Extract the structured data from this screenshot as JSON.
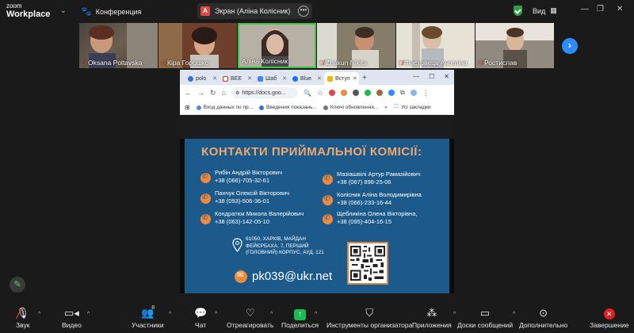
{
  "app": {
    "logo_top": "zoom",
    "logo_bottom": "Workplace"
  },
  "meeting": {
    "title": "Конференция"
  },
  "screen_share": {
    "badge": "А",
    "label": "Экран (Аліна Колісник)"
  },
  "view": {
    "label": "Вид"
  },
  "participants": [
    {
      "name": "Oksana Poltavska",
      "muted": true
    },
    {
      "name": "Кіра Горошко",
      "muted": true
    },
    {
      "name": "Аліна Колісник",
      "muted": false
    },
    {
      "name": "Zhakun Nikita",
      "muted": true
    },
    {
      "name": "Фастовець Ангеліна",
      "muted": true
    },
    {
      "name": "Ростислав",
      "muted": true
    }
  ],
  "browser": {
    "tabs": [
      {
        "label": "polo",
        "color": "#3b6fd8"
      },
      {
        "label": "ВЕЕ",
        "color": "#d93025"
      },
      {
        "label": "Шаб",
        "color": "#4285f4"
      },
      {
        "label": "Blue",
        "color": "#1a73e8"
      },
      {
        "label": "Вступ",
        "color": "#f5b400"
      }
    ],
    "url": "https://docs.goo...",
    "bookmarks": [
      "Вход данных по пр...",
      "Введения показань...",
      "Ключі обновлення...",
      "Усі закладки"
    ]
  },
  "slide": {
    "title": "КОНТАКТИ ПРИЙМАЛЬНОЇ КОМІСІЇ:",
    "contacts_left": [
      {
        "name": "Рибін Андрій Вікторович",
        "phone": "+38 (066)-705-32-61"
      },
      {
        "name": "Панчук Олексій Вікторович",
        "phone": "+38 (093)-506-36-01"
      },
      {
        "name": "Кондратюк Микола Валерійович",
        "phone": "+38 (063)-142-05-10"
      }
    ],
    "contacts_right": [
      {
        "name": "Мазіашвілі Артур Рамазійович",
        "phone": "+38 (067) 898-25-06"
      },
      {
        "name": "Колісник Аліна Володимирівна",
        "phone": "+38 (066)-233-16-44"
      },
      {
        "name": "Щебликіна Олена Вікторівна,",
        "phone": "+38 (095)-404-16-15"
      }
    ],
    "address": "61050, ХАРКІВ, МАЙДАН ФЕЙЄРБАХА, 7, ПЕРШИЙ (ГОЛОВНИЙ) КОРПУС, АУД. 121",
    "email": "pk039@ukr.net"
  },
  "toolbar": {
    "audio": "Звук",
    "video": "Видео",
    "participants": "Участники",
    "participants_count": "8",
    "chat": "Чат",
    "react": "Отреагировать",
    "share": "Поделиться",
    "host_tools": "Инструменты организатора",
    "apps": "Приложения",
    "whiteboards": "Доски сообщений",
    "more": "Дополнительно",
    "end": "Завершение"
  }
}
